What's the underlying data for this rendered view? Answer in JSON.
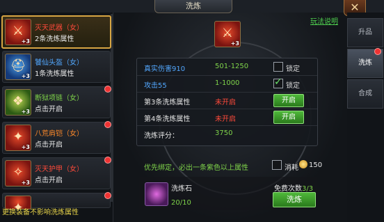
{
  "window": {
    "title": "洗炼",
    "close_glyph": "✕",
    "help_link": "玩法说明"
  },
  "equipment": [
    {
      "name": "灭天武器（女）",
      "sub": "2条洗炼属性",
      "name_color": "red",
      "icon": "sword-icon",
      "icon_bg": "red",
      "plus": "+3",
      "selected": true,
      "notif": false
    },
    {
      "name": "饕仙头盔（女）",
      "sub": "1条洗炼属性",
      "name_color": "blue",
      "icon": "helmet-icon",
      "icon_bg": "blue",
      "plus": "+3",
      "selected": false,
      "notif": false
    },
    {
      "name": "断狱项链（女）",
      "sub": "点击开启",
      "name_color": "green",
      "icon": "necklace-icon",
      "icon_bg": "green",
      "plus": "+3",
      "selected": false,
      "notif": true
    },
    {
      "name": "八荒肩铠（女）",
      "sub": "点击开启",
      "name_color": "orange",
      "icon": "shoulder-icon",
      "icon_bg": "red",
      "plus": "+3",
      "selected": false,
      "notif": true
    },
    {
      "name": "灭天护甲（女）",
      "sub": "点击开启",
      "name_color": "red",
      "icon": "armor-icon",
      "icon_bg": "red",
      "plus": "+3",
      "selected": false,
      "notif": true
    },
    {
      "name": "",
      "sub": "",
      "name_color": "red",
      "icon": "item-icon",
      "icon_bg": "red",
      "plus": "",
      "selected": false,
      "notif": true
    }
  ],
  "footer_note": "更换装备不影响洗炼属性",
  "current_item": {
    "plus": "+3",
    "icon": "sword-icon"
  },
  "stats": [
    {
      "label": "真实伤害910",
      "label_color": "blue",
      "value": "501-1250",
      "value_color": "green",
      "control": "lock",
      "checked": false,
      "control_label": "锁定"
    },
    {
      "label": "攻击55",
      "label_color": "blue",
      "value": "1-1000",
      "value_color": "green",
      "control": "lock",
      "checked": true,
      "control_label": "锁定"
    },
    {
      "label": "第3条洗炼属性",
      "label_color": "white",
      "value": "未开启",
      "value_color": "red",
      "control": "open",
      "control_label": "开启"
    },
    {
      "label": "第4条洗炼属性",
      "label_color": "white",
      "value": "未开启",
      "value_color": "red",
      "control": "open",
      "control_label": "开启"
    },
    {
      "label": "洗炼评分：",
      "label_color": "white",
      "value": "3750",
      "value_color": "green",
      "control": "none"
    }
  ],
  "priority_text": "优先绑定，必出一条紫色以上属性",
  "consume": {
    "label": "消耗",
    "cost": "150"
  },
  "stone": {
    "name": "洗炼石",
    "count": "20/10"
  },
  "free": {
    "label": "免费次数",
    "count": "3/3"
  },
  "refine_button": "洗炼",
  "tabs": [
    {
      "label": "升品",
      "active": false,
      "notif": false
    },
    {
      "label": "洗炼",
      "active": true,
      "notif": true
    },
    {
      "label": "合成",
      "active": false,
      "notif": false
    }
  ],
  "colors": {
    "accent_gold": "#d7a543",
    "green": "#7fd44a",
    "red": "#ff4a3a",
    "blue": "#52a8ff"
  }
}
